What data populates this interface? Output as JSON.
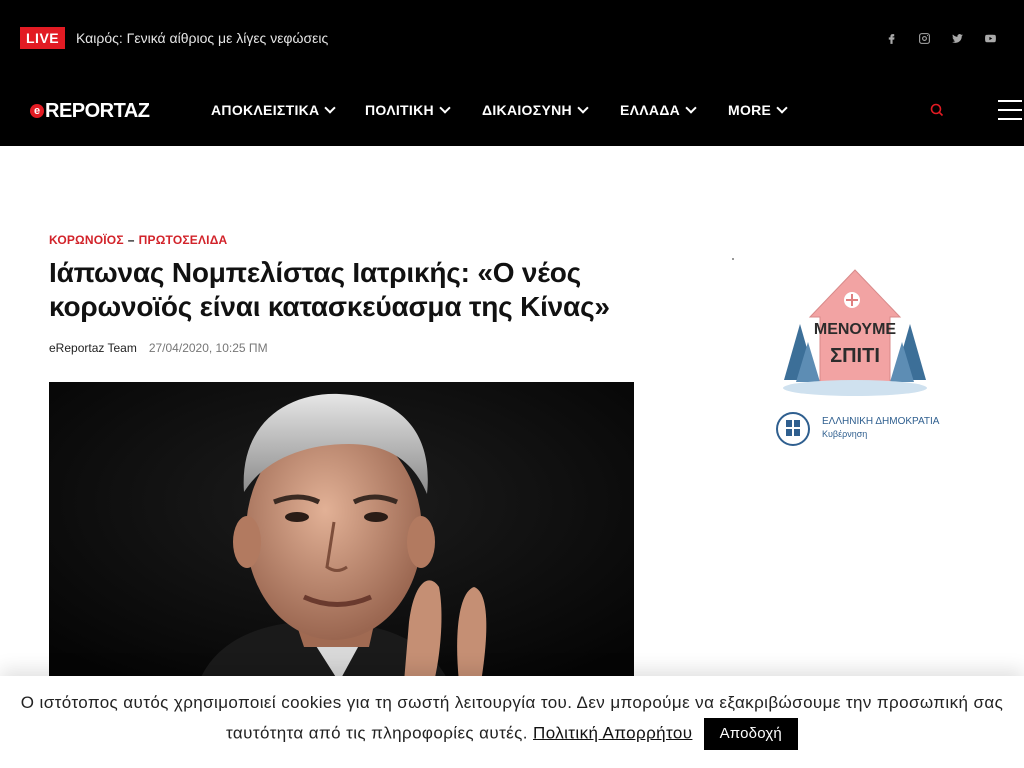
{
  "topbar": {
    "live_label": "LIVE",
    "weather_text": "Καιρός: Γενικά αίθριος με λίγες νεφώσεις",
    "social": [
      "facebook-icon",
      "instagram-icon",
      "twitter-icon",
      "youtube-icon"
    ]
  },
  "header": {
    "logo_mark": "e",
    "logo_text": "REPORTAZ",
    "nav": [
      {
        "label": "ΑΠΟΚΛΕΙΣΤΙΚΑ"
      },
      {
        "label": "ΠΟΛΙΤΙΚΗ"
      },
      {
        "label": "ΔΙΚΑΙΟΣΥΝΗ"
      },
      {
        "label": "ΕΛΛΑΔΑ"
      },
      {
        "label": "MORE"
      }
    ]
  },
  "article": {
    "categories": [
      "ΚΟΡΩΝΟΪΟΣ",
      "ΠΡΩΤΟΣΕΛΙΔΑ"
    ],
    "category_separator": "–",
    "title": "Ιάπωνας Νομπελίστας Ιατρικής: «Ο νέος κορωνοϊός είναι κατασκεύασμα της Κίνας»",
    "author": "eReportaz Team",
    "date": "27/04/2020, 10:25 ΠΜ"
  },
  "sidebar_ad": {
    "headline_line1": "ΜΕΝΟΥΜΕ",
    "headline_line2": "ΣΠΙΤΙ",
    "gov_line1": "ΕΛΛΗΝΙΚΗ ΔΗΜΟΚΡΑΤΙΑ",
    "gov_line2": "Κυβέρνηση"
  },
  "cookie": {
    "text": "Ο ιστότοπος αυτός χρησιμοποιεί cookies για τη σωστή λειτουργία του. Δεν μπορούμε να εξακριβώσουμε την προσωπική σας ταυτότητα από τις πληροφορίες αυτές.",
    "policy_link": "Πολιτική Απορρήτου",
    "accept_label": "Αποδοχή"
  },
  "colors": {
    "accent": "#e21b23",
    "nav_bg": "#000000"
  }
}
